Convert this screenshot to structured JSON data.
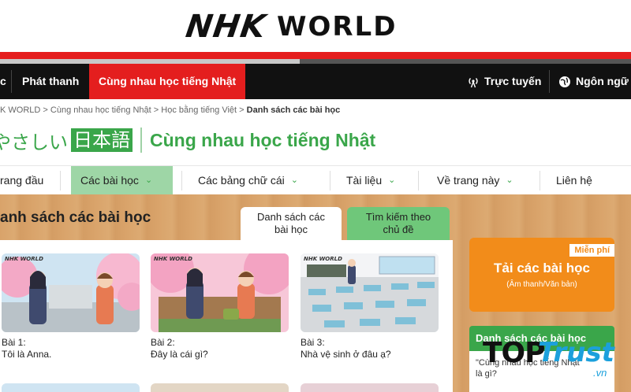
{
  "header": {
    "logo_nhk": "NHK",
    "logo_world": "WORLD"
  },
  "navbar": {
    "left_stub": "c",
    "items": [
      "Phát thanh",
      "Cùng nhau học tiếng Nhật"
    ],
    "live": "Trực tuyến",
    "language": "Ngôn ngữ"
  },
  "breadcrumb": {
    "items": [
      "K WORLD",
      "Cùng nhau học tiếng Nhật",
      "Học bằng tiếng Việt"
    ],
    "separator": ">",
    "current": "Danh sách các bài học"
  },
  "brand": {
    "jp_kana": "やさしい",
    "jp_kanji": "日本語",
    "title": "Cùng nhau học tiếng Nhật"
  },
  "subnav": {
    "items": [
      "rang đầu",
      "Các bài học",
      "Các bảng chữ cái",
      "Tài liệu",
      "Về trang này",
      "Liên hệ"
    ]
  },
  "main": {
    "heading": "anh sách các bài học",
    "tabs": [
      {
        "line1": "Danh sách các",
        "line2": "bài học"
      },
      {
        "line1": "Tìm kiếm theo",
        "line2": "chủ đề"
      }
    ],
    "lessons": [
      {
        "num": "Bài 1:",
        "title": "Tôi là Anna."
      },
      {
        "num": "Bài 2:",
        "title": "Đây là cái gì?"
      },
      {
        "num": "Bài 3:",
        "title": "Nhà vệ sinh ở đâu ạ?"
      }
    ],
    "thumb_watermark": "NHK WORLD"
  },
  "sidebar": {
    "download_badge": "Miễn phí",
    "download_title": "Tải các bài học",
    "download_sub": "(Âm thanh/Văn bản)",
    "list_title": "Danh sách các bài học",
    "list_line1": "\"Cùng nhau học tiếng Nhật\"",
    "list_line2": "là gì?"
  },
  "watermark": {
    "top": "TOP",
    "trust": "Trust",
    "vn": ".vn"
  },
  "colors": {
    "accent_red": "#e41e1e",
    "green": "#3aa64a",
    "light_green": "#9ed6a6",
    "orange": "#f28c1a"
  }
}
